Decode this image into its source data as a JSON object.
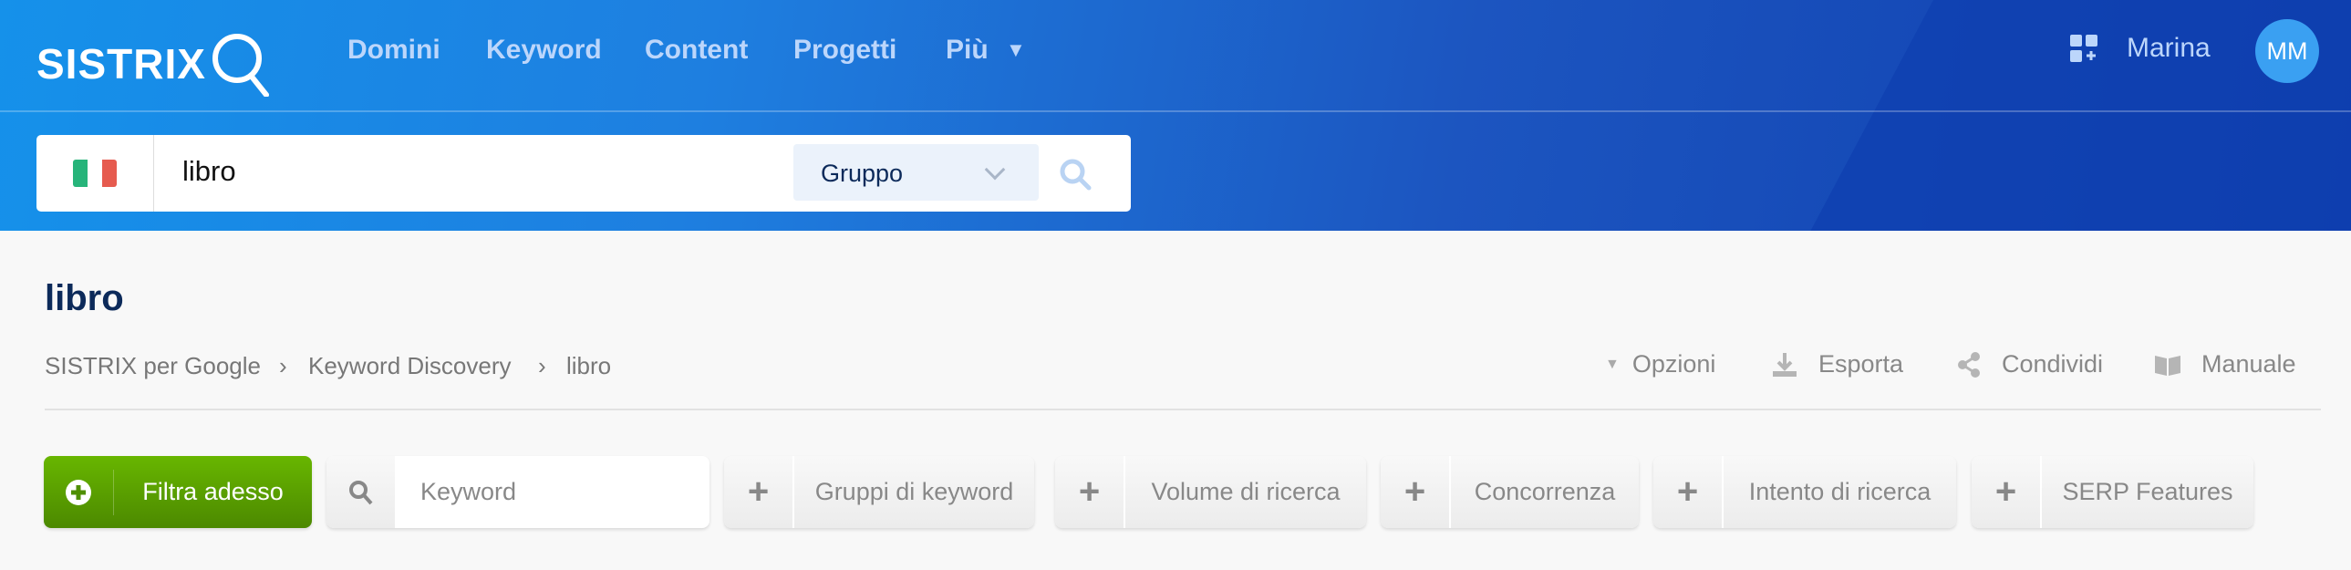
{
  "brand": {
    "logo_text": "SISTRIX"
  },
  "nav": {
    "items": [
      "Domini",
      "Keyword",
      "Content",
      "Progetti",
      "Più"
    ]
  },
  "user": {
    "name": "Marina",
    "initials": "MM"
  },
  "search": {
    "country": "Italia",
    "query": "libro",
    "mode": "Gruppo"
  },
  "page": {
    "title": "libro",
    "breadcrumb": [
      "SISTRIX per Google",
      "Keyword Discovery",
      "libro"
    ],
    "actions": [
      "Opzioni",
      "Esporta",
      "Condividi",
      "Manuale"
    ]
  },
  "filters": {
    "primary": "Filtra adesso",
    "keyword_placeholder": "Keyword",
    "items": [
      "Gruppi di keyword",
      "Volume di ricerca",
      "Concorrenza",
      "Intento di ricerca",
      "SERP Features"
    ]
  },
  "colors": {
    "header": "#1c6fdc",
    "accent_green": "#5ea300",
    "avatar": "#3aa0f2",
    "title": "#0c2a5a"
  }
}
